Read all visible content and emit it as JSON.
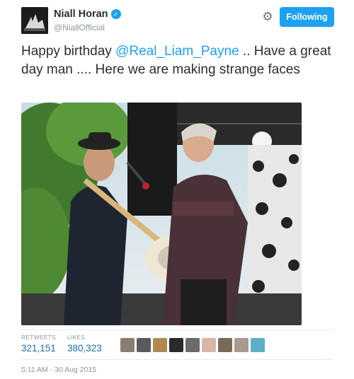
{
  "user": {
    "name": "Niall Horan",
    "handle": "@NiallOfficial",
    "verified_icon": "verified-badge-icon"
  },
  "actions": {
    "settings_icon": "gear-icon",
    "follow_label": "Following"
  },
  "tweet": {
    "text_prefix": "Happy birthday ",
    "mention": "@Real_Liam_Payne",
    "text_suffix": " .. Have a great day man .... Here we are making strange faces"
  },
  "stats": {
    "retweets_label": "RETWEETS",
    "retweets_value": "321,151",
    "likes_label": "LIKES",
    "likes_value": "380,323"
  },
  "likers": [
    {
      "color": "#8a7d70"
    },
    {
      "color": "#5a5a5a"
    },
    {
      "color": "#b08850"
    },
    {
      "color": "#2a2a2a"
    },
    {
      "color": "#6b6b6b"
    },
    {
      "color": "#d7b7a6"
    },
    {
      "color": "#7a6a5a"
    },
    {
      "color": "#a89a8c"
    },
    {
      "color": "#5bb0c8"
    }
  ],
  "timestamp": "5:11 AM - 30 Aug 2015",
  "colors": {
    "accent": "#1da1f2",
    "text": "#292f33",
    "muted": "#8899a6"
  }
}
